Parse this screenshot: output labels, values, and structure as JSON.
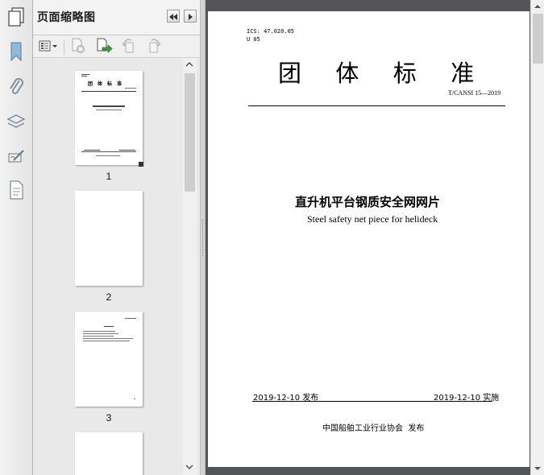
{
  "panel": {
    "title": "页面缩略图",
    "thumbnails": [
      {
        "page_number": "1"
      },
      {
        "page_number": "2"
      },
      {
        "page_number": "3"
      }
    ]
  },
  "document": {
    "ics": "ICS: 47.020.05",
    "ccs": "U 05",
    "header_title": "团  体  标  准",
    "standard_number": "T/CANSI 15—2019",
    "title_cn": "直升机平台钢质安全网网片",
    "title_en": "Steel safety net piece for helideck",
    "issue_date": "2019-12-10 发布",
    "implement_date": "2019-12-10 实施",
    "publisher": "中国船舶工业行业协会  发布"
  },
  "colors": {
    "doc_background": "#525659",
    "panel_background": "#f0f0f0",
    "page": "#ffffff"
  },
  "icons": [
    "pages-panel-icon",
    "bookmark-icon",
    "attachment-icon",
    "layers-icon",
    "signature-icon",
    "content-icon",
    "first-page-icon",
    "next-page-icon",
    "thumbnail-options-icon",
    "delete-page-icon",
    "insert-pages-icon",
    "rotate-ccw-icon",
    "rotate-cw-icon"
  ]
}
